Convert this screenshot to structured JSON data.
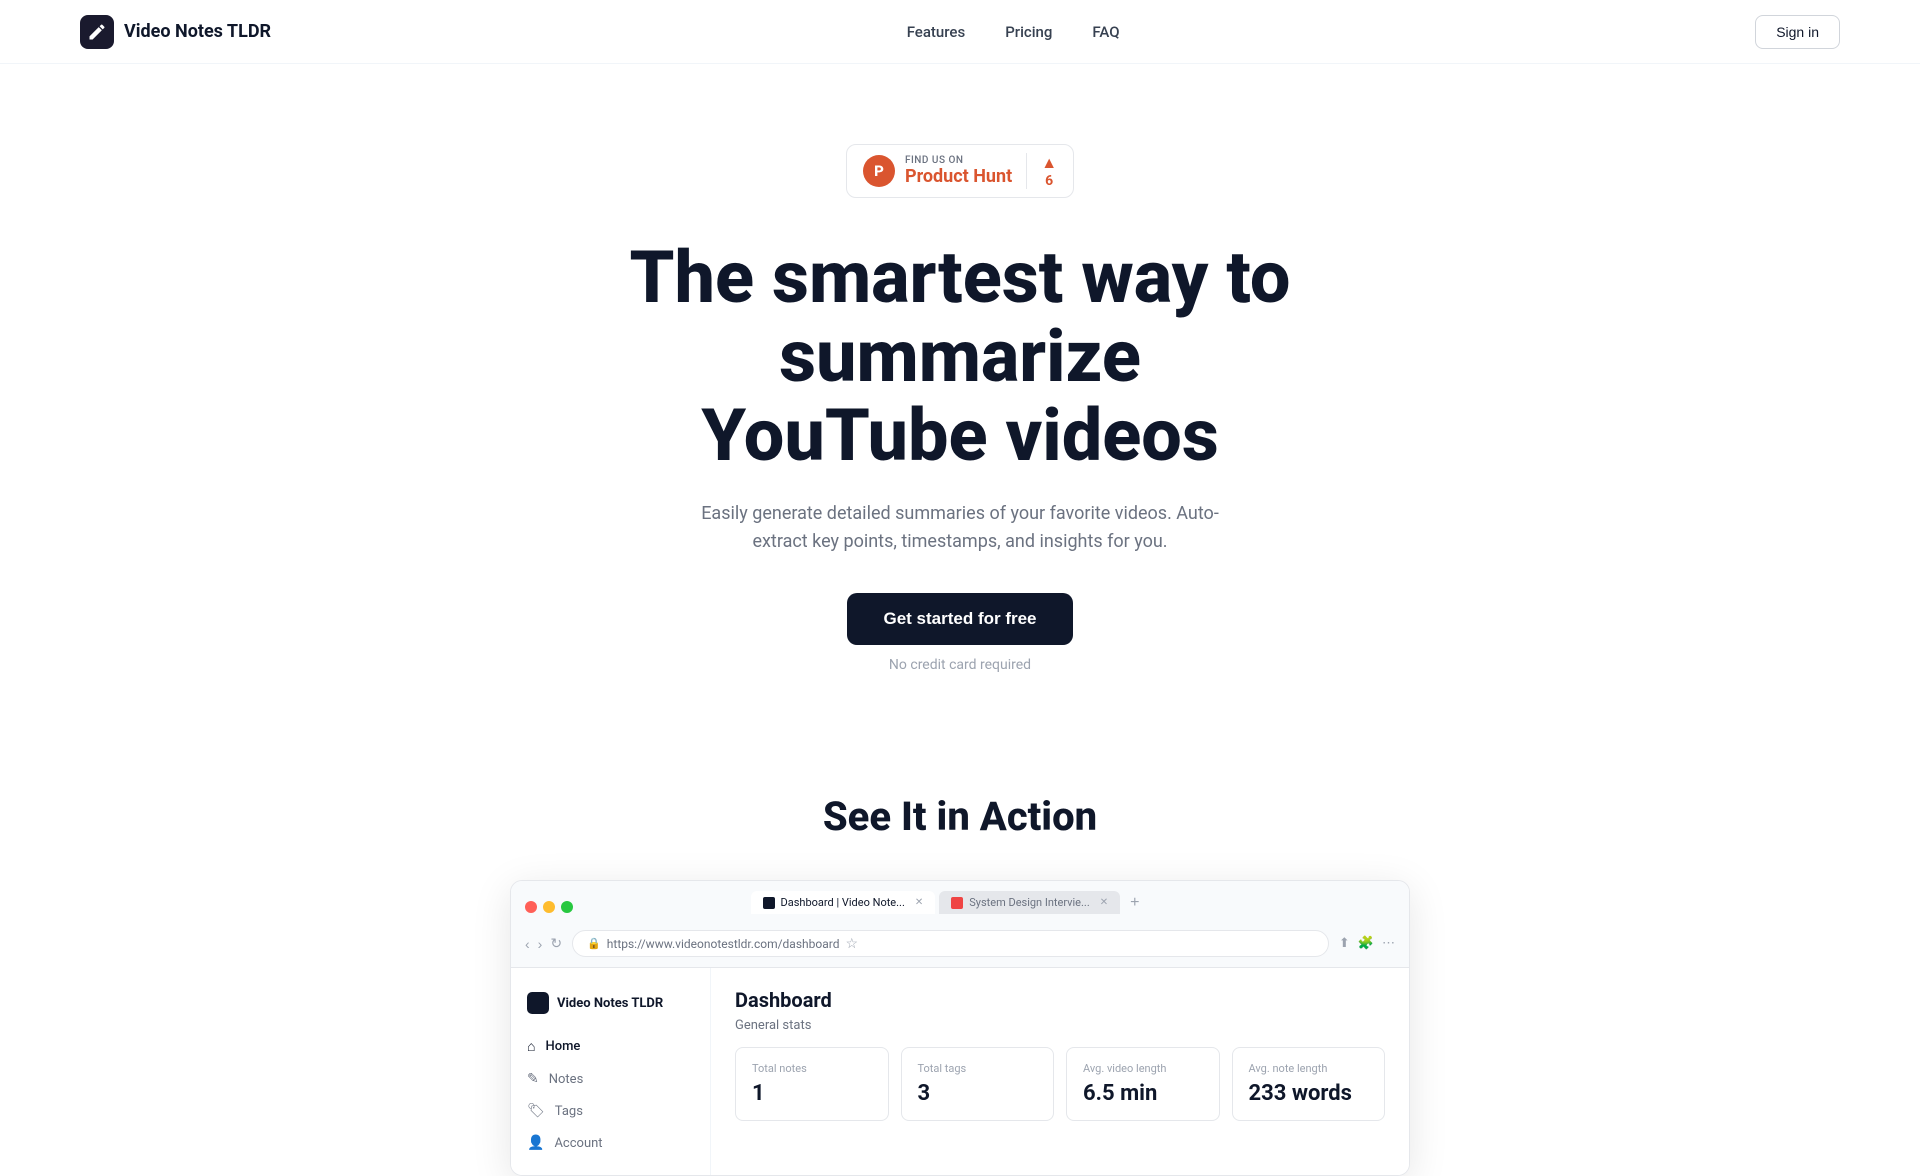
{
  "brand": {
    "name": "Video Notes TLDR",
    "logo_letter": "✎"
  },
  "navbar": {
    "links": [
      {
        "label": "Features",
        "href": "#"
      },
      {
        "label": "Pricing",
        "href": "#"
      },
      {
        "label": "FAQ",
        "href": "#"
      }
    ],
    "sign_in": "Sign in"
  },
  "product_hunt": {
    "find_us_on": "FIND US ON",
    "name": "Product Hunt",
    "votes": "6",
    "letter": "P"
  },
  "hero": {
    "title_line1": "The smartest way to summarize",
    "title_line2": "YouTube videos",
    "subtitle": "Easily generate detailed summaries of your favorite videos. Auto-extract key points, timestamps, and insights for you.",
    "cta_label": "Get started for free",
    "no_cc": "No credit card required"
  },
  "see_action": {
    "title": "See It in Action"
  },
  "browser_mockup": {
    "tabs": [
      {
        "label": "Dashboard | Video Note...",
        "active": true,
        "favicon_type": "dark"
      },
      {
        "label": "System Design Intervie...",
        "active": false,
        "favicon_type": "red"
      }
    ],
    "address": "https://www.videonotestldr.com/dashboard",
    "add_tab": "+"
  },
  "app": {
    "sidebar_brand": "Video Notes TLDR",
    "nav_items": [
      {
        "icon": "⌂",
        "label": "Home",
        "active": true
      },
      {
        "icon": "✎",
        "label": "Notes",
        "active": false
      },
      {
        "icon": "🏷",
        "label": "Tags",
        "active": false
      },
      {
        "icon": "👤",
        "label": "Account",
        "active": false
      }
    ],
    "dashboard": {
      "title": "Dashboard",
      "general_stats_label": "General stats",
      "stats": [
        {
          "label": "Total notes",
          "value": "1"
        },
        {
          "label": "Total tags",
          "value": "3"
        },
        {
          "label": "Avg. video length",
          "value": "6.5 min"
        },
        {
          "label": "Avg. note length",
          "value": "233 words"
        }
      ]
    }
  }
}
